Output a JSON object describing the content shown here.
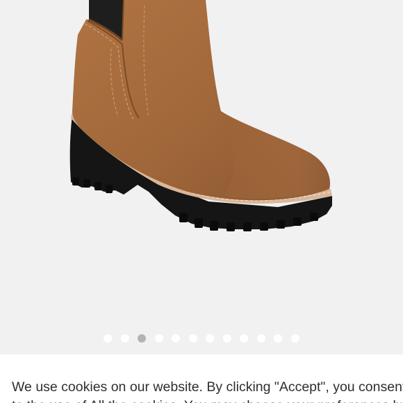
{
  "carousel": {
    "dot_count": 12,
    "active_index": 2,
    "colors": {
      "dot": "#ffffff",
      "active_dot": "#b3b3b3"
    }
  },
  "product_image": {
    "description_icon": "suede-chelsea-boot-icon",
    "colors": {
      "suede": "#a0673a",
      "sole": "#151515",
      "welt": "#d9b79a",
      "elastic": "#1e1e1e"
    }
  },
  "cookie_banner": {
    "text_line1": "We use cookies on our website. By clicking \"Accept\", you consent",
    "text_line2": "to the use of All the cookies. You may choose your preferences by"
  }
}
